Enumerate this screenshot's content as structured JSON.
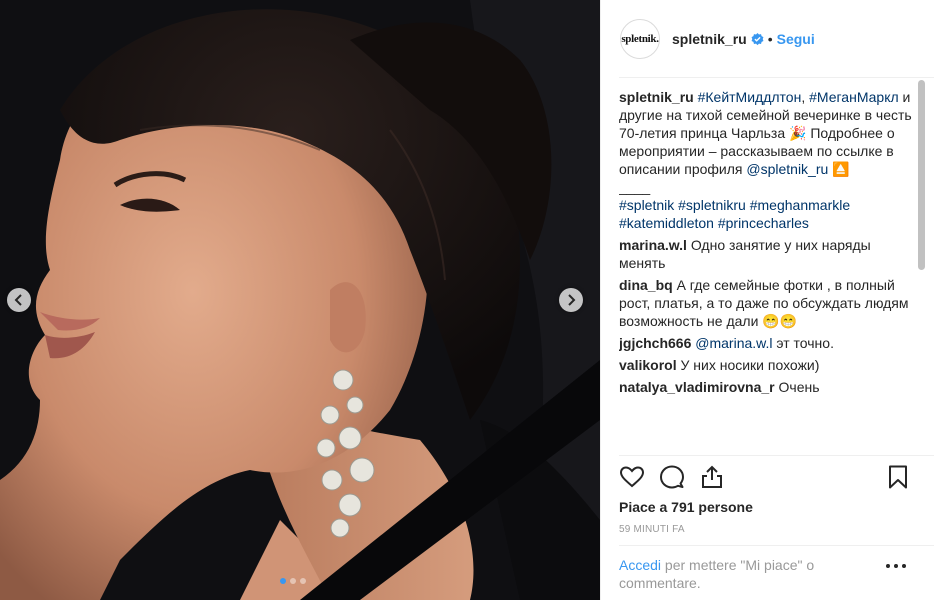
{
  "post": {
    "image_alt": "",
    "carousel": {
      "count": 3,
      "active": 0
    }
  },
  "header": {
    "avatar_text": "spletnik.",
    "username": "spletnik_ru",
    "separator": "•",
    "follow_label": "Segui"
  },
  "caption": {
    "username": "spletnik_ru",
    "tag1": "#КейтМиддлтон",
    "text1": ",",
    "tag2": "#МеганМаркл",
    "text2": " и другие на тихой семейной вечеринке в честь 70-летия принца Чарльза 🎉 Подробнее о мероприятии – рассказываем по ссылке в описании профиля ",
    "mention": "@spletnik_ru",
    "emoji": "⏏️",
    "separator": "____",
    "hashtags": "#spletnik #spletnikru #meghanmarkle #katemiddleton #princecharles"
  },
  "comments": [
    {
      "user": "marina.w.l",
      "mention": "",
      "text": "Одно занятие у них наряды менять"
    },
    {
      "user": "dina_bq",
      "mention": "",
      "text": "А где семейные фотки , в полный рост, платья, а то даже по обсуждать людям возможность не дали 😁😁"
    },
    {
      "user": "jgjchch666",
      "mention": "@marina.w.l",
      "text": " эт точно."
    },
    {
      "user": "valikorol",
      "mention": "",
      "text": "У них носики похожи)"
    },
    {
      "user": "natalya_vladimirovna_r",
      "mention": "",
      "text": "Очень"
    }
  ],
  "likes": {
    "prefix": "Piace a ",
    "count": "791 persone"
  },
  "timestamp": "59 MINUTI FA",
  "login": {
    "link": "Accedi",
    "text": " per mettere \"Mi piace\" o commentare."
  },
  "icons": {
    "verified": "verified-badge-icon",
    "like": "heart-icon",
    "comment": "speech-bubble-icon",
    "share": "share-icon",
    "save": "bookmark-icon",
    "more": "more-dots-icon",
    "prev": "chevron-left-icon",
    "next": "chevron-right-icon"
  },
  "colors": {
    "accent": "#3897f0",
    "hashtag": "#003569",
    "muted": "#999999"
  }
}
